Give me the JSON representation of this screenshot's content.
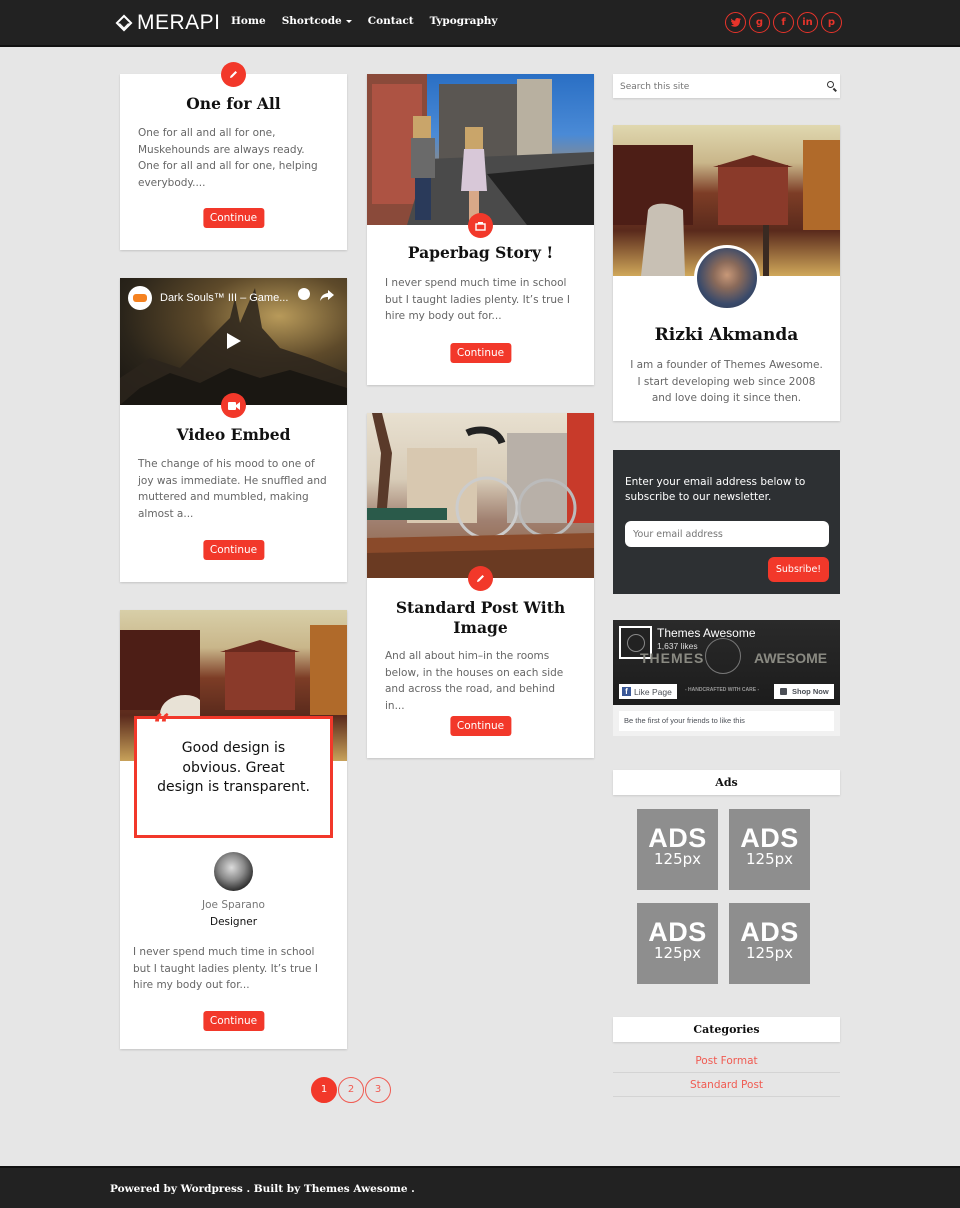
{
  "header": {
    "logo_text": "MERAPI",
    "nav": [
      {
        "label": "Home"
      },
      {
        "label": "Shortcode",
        "has_dropdown": true
      },
      {
        "label": "Contact"
      },
      {
        "label": "Typography"
      }
    ],
    "social": [
      {
        "name": "twitter",
        "glyph": "t"
      },
      {
        "name": "google-plus",
        "glyph": "g"
      },
      {
        "name": "facebook",
        "glyph": "f"
      },
      {
        "name": "linkedin",
        "glyph": "in"
      },
      {
        "name": "pinterest",
        "glyph": "p"
      }
    ]
  },
  "posts": {
    "one_for_all": {
      "title": "One for All",
      "excerpt": "One for all and all for one, Muskehounds are always ready. One for all and all for one, helping everybody....",
      "button": "Continue",
      "icon": "pencil-icon"
    },
    "video_embed": {
      "video_title": "Dark Souls™ III – Game...",
      "title": "Video Embed",
      "excerpt": "The change of his mood to one of joy was immediate. He snuffled and muttered and mumbled, making almost a...",
      "button": "Continue",
      "icon": "video-camera-icon"
    },
    "quote": {
      "quote": "Good design is obvious. Great design is transparent.",
      "author": "Joe Sparano",
      "role": "Designer",
      "excerpt": "I never spend much time in school but I taught ladies plenty. It’s true I hire my body out for...",
      "button": "Continue"
    },
    "paperbag": {
      "title": "Paperbag Story !",
      "excerpt": "I never spend much time in school but I taught ladies plenty. It’s true I hire my body out for...",
      "button": "Continue",
      "icon": "gallery-icon"
    },
    "standard_image": {
      "title": "Standard Post With Image",
      "excerpt": "And all about him–in the rooms below, in the houses on each side and across the road, and behind in...",
      "button": "Continue",
      "icon": "pencil-icon"
    }
  },
  "pagination": {
    "pages": [
      "1",
      "2",
      "3"
    ],
    "current": "1"
  },
  "sidebar": {
    "search_placeholder": "Search this site",
    "profile": {
      "name": "Rizki Akmanda",
      "bio": "I am a founder of Themes Awesome. I start developing web since 2008 and love doing it since then."
    },
    "newsletter": {
      "text": "Enter your email address below to subscribe to our newsletter.",
      "placeholder": "Your email address",
      "button": "Subsribe!"
    },
    "facebook": {
      "page_name": "Themes Awesome",
      "likes": "1,637 likes",
      "cover_left": "THEMES",
      "cover_right": "AWESOME",
      "tagline": "- HANDCRAFTED WITH CARE -",
      "like_button": "Like Page",
      "shop_button": "Shop Now",
      "friends_text": "Be the first of your friends to like this"
    },
    "ads": {
      "title": "Ads",
      "items": [
        {
          "label": "ADS",
          "size": "125px"
        },
        {
          "label": "ADS",
          "size": "125px"
        },
        {
          "label": "ADS",
          "size": "125px"
        },
        {
          "label": "ADS",
          "size": "125px"
        }
      ]
    },
    "categories": {
      "title": "Categories",
      "items": [
        {
          "label": "Post Format"
        },
        {
          "label": "Standard Post"
        }
      ]
    }
  },
  "footer": {
    "text": "Powered by Wordpress . Built by Themes Awesome ."
  },
  "colors": {
    "accent": "#f2382a",
    "header_bg": "#222222",
    "page_bg": "#e6e6e6",
    "newsletter_bg": "#2d3033"
  }
}
